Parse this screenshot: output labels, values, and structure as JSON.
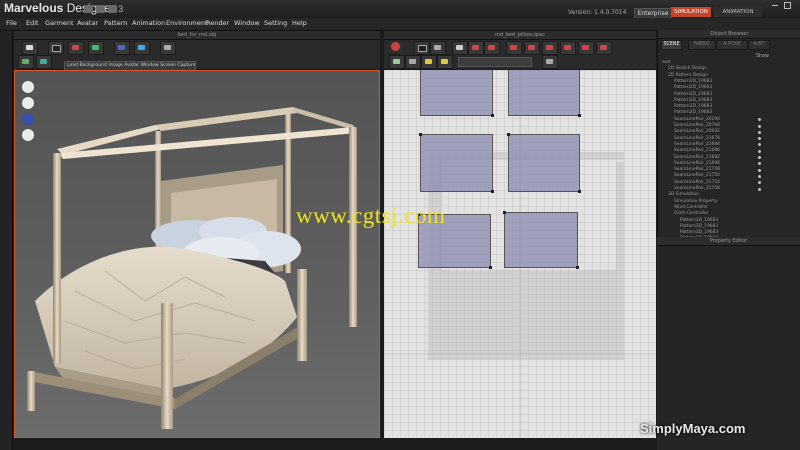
{
  "app": {
    "name": "Marvelous",
    "name_suffix": " Designer",
    "major_version": "3",
    "version_text": "Version:  1.4.0.7014",
    "edition": "Enterprise",
    "modes": {
      "simulation": "SIMULATION",
      "animation": "ANIMATION"
    }
  },
  "menu": [
    "File",
    "Edit",
    "Garment",
    "Avatar",
    "Pattern",
    "Animation",
    "Environment",
    "Render",
    "Window",
    "Setting",
    "Help"
  ],
  "panels": {
    "view3d_title": "bed_for_md.obj",
    "view2d_title": "md_bed_pillow.zpac",
    "view3d_hint": "Load Background Image  Avatar Window  Screen Capture",
    "object_browser_title": "Object Browser",
    "property_editor_title": "Property Editor"
  },
  "object_browser": {
    "tabs": [
      "SCENE",
      "FABRIC",
      "A-POSE",
      "A-BT"
    ],
    "show_label": "Show",
    "tree": [
      {
        "label": "Sed",
        "indent": 0,
        "dot": false
      },
      {
        "label": "2D Sketch Design",
        "indent": 1,
        "dot": false
      },
      {
        "label": "2D Pattern Design",
        "indent": 1,
        "dot": false
      },
      {
        "label": "Pattern2D_19683",
        "indent": 2,
        "dot": false
      },
      {
        "label": "Pattern2D_19683",
        "indent": 2,
        "dot": false
      },
      {
        "label": "Pattern2D_19683",
        "indent": 2,
        "dot": false
      },
      {
        "label": "Pattern2D_19683",
        "indent": 2,
        "dot": false
      },
      {
        "label": "Pattern2D_19683",
        "indent": 2,
        "dot": false
      },
      {
        "label": "Pattern2D_19683",
        "indent": 2,
        "dot": false
      },
      {
        "label": "SeamLinePair_20194",
        "indent": 2,
        "dot": true
      },
      {
        "label": "SeamLinePair_20768",
        "indent": 2,
        "dot": true
      },
      {
        "label": "SeamLinePair_20092",
        "indent": 2,
        "dot": true
      },
      {
        "label": "SeamLinePair_21678",
        "indent": 2,
        "dot": true
      },
      {
        "label": "SeamLinePair_21684",
        "indent": 2,
        "dot": true
      },
      {
        "label": "SeamLinePair_21686",
        "indent": 2,
        "dot": true
      },
      {
        "label": "SeamLinePair_21682",
        "indent": 2,
        "dot": true
      },
      {
        "label": "SeamLinePair_21696",
        "indent": 2,
        "dot": true
      },
      {
        "label": "SeamLinePair_21748",
        "indent": 2,
        "dot": true
      },
      {
        "label": "SeamLinePair_21750",
        "indent": 2,
        "dot": true
      },
      {
        "label": "SeamLinePair_21754",
        "indent": 2,
        "dot": true
      },
      {
        "label": "SeamLinePair_21758",
        "indent": 2,
        "dot": true
      },
      {
        "label": "3D Simulation",
        "indent": 1,
        "dot": false
      },
      {
        "label": "Simulation Property",
        "indent": 2,
        "dot": false
      },
      {
        "label": "Wind Controller",
        "indent": 2,
        "dot": false
      },
      {
        "label": "Cloth Controller",
        "indent": 2,
        "dot": false
      },
      {
        "label": "Pattern3D_19683",
        "indent": 3,
        "dot": false
      },
      {
        "label": "Pattern3D_19683",
        "indent": 3,
        "dot": false
      },
      {
        "label": "Pattern3D_19683",
        "indent": 3,
        "dot": false
      },
      {
        "label": "Pattern3D_19683",
        "indent": 3,
        "dot": false
      },
      {
        "label": "Pattern3D_19683",
        "indent": 3,
        "dot": false
      },
      {
        "label": "Pattern3D_19683",
        "indent": 3,
        "dot": false
      }
    ]
  },
  "watermarks": {
    "site": "www.cgtsj.com",
    "brand": "SimplyMaya.com"
  },
  "colors": {
    "accent": "#d8562e",
    "pattern_fill": "#8a8ab0",
    "site_watermark": "#f1e21a"
  }
}
